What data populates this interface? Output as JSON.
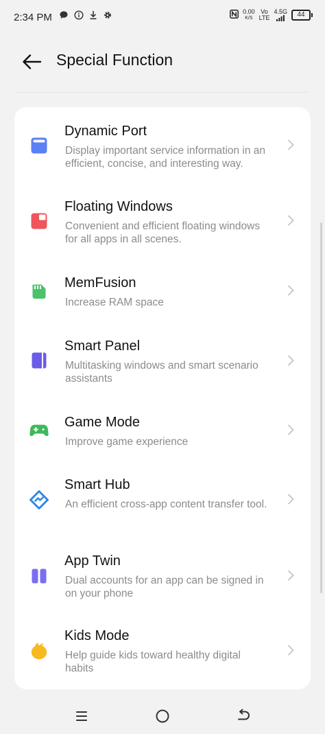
{
  "status_bar": {
    "time": "2:34 PM",
    "net_speed_value": "0.00",
    "net_speed_unit": "K/S",
    "volte_top": "Vo",
    "volte_bottom": "LTE",
    "network": "4.5G",
    "battery_level": "44"
  },
  "header": {
    "title": "Special Function"
  },
  "features": [
    {
      "title": "Dynamic Port",
      "description": "Display important service information in an efficient, concise, and interesting way.",
      "icon": "dynamic-port-icon",
      "color": "#5b7ff5"
    },
    {
      "title": "Floating Windows",
      "description": "Convenient and efficient floating windows for all apps in all scenes.",
      "icon": "floating-windows-icon",
      "color": "#f0545c"
    },
    {
      "title": "MemFusion",
      "description": "Increase RAM space",
      "icon": "memory-card-icon",
      "color": "#4cc26b"
    },
    {
      "title": "Smart Panel",
      "description": "Multitasking windows and smart scenario assistants",
      "icon": "side-panel-icon",
      "color": "#6b5ce7"
    },
    {
      "title": "Game Mode",
      "description": "Improve game experience",
      "icon": "gamepad-icon",
      "color": "#3fb95a"
    },
    {
      "title": "Smart Hub",
      "description": "An efficient cross-app content transfer tool.",
      "icon": "smart-hub-icon",
      "color": "#2f86e8"
    },
    {
      "title": "App Twin",
      "description": "Dual accounts for an app can be signed in on your phone",
      "icon": "app-twin-icon",
      "color": "#7a6ef0"
    },
    {
      "title": "Kids Mode",
      "description": "Help guide kids toward healthy digital habits",
      "icon": "kids-mode-icon",
      "color": "#f8b81f"
    }
  ]
}
